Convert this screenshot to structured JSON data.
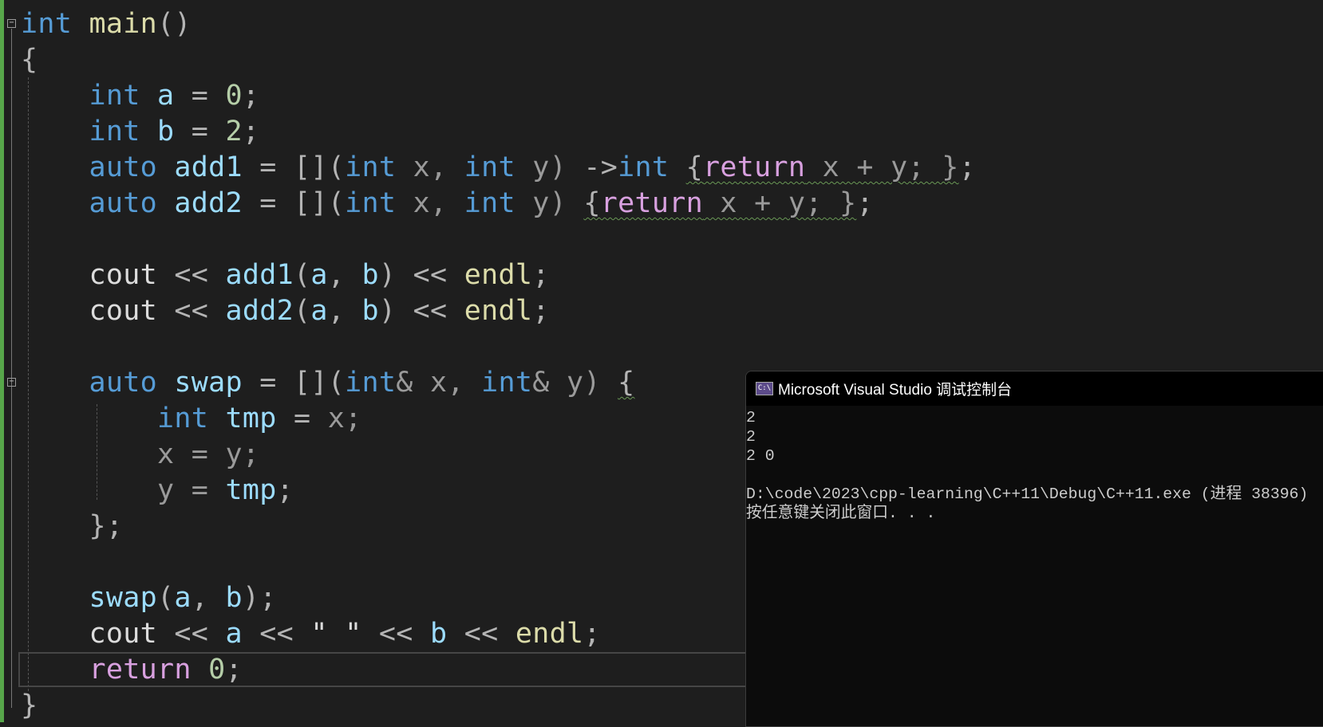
{
  "editor": {
    "lines": [
      [
        {
          "t": "int",
          "c": "kw"
        },
        {
          "t": " ",
          "c": "id"
        },
        {
          "t": "main",
          "c": "fn"
        },
        {
          "t": "()",
          "c": "pun"
        }
      ],
      [
        {
          "t": "{",
          "c": "pun"
        }
      ],
      [
        {
          "t": "    ",
          "c": "id"
        },
        {
          "t": "int",
          "c": "kw"
        },
        {
          "t": " ",
          "c": "id"
        },
        {
          "t": "a",
          "c": "var"
        },
        {
          "t": " = ",
          "c": "pun"
        },
        {
          "t": "0",
          "c": "num"
        },
        {
          "t": ";",
          "c": "pun"
        }
      ],
      [
        {
          "t": "    ",
          "c": "id"
        },
        {
          "t": "int",
          "c": "kw"
        },
        {
          "t": " ",
          "c": "id"
        },
        {
          "t": "b",
          "c": "var"
        },
        {
          "t": " = ",
          "c": "pun"
        },
        {
          "t": "2",
          "c": "num"
        },
        {
          "t": ";",
          "c": "pun"
        }
      ],
      [
        {
          "t": "    ",
          "c": "id"
        },
        {
          "t": "auto",
          "c": "kw"
        },
        {
          "t": " ",
          "c": "id"
        },
        {
          "t": "add1",
          "c": "var"
        },
        {
          "t": " = [](",
          "c": "pun"
        },
        {
          "t": "int",
          "c": "kw"
        },
        {
          "t": " x, ",
          "c": "par"
        },
        {
          "t": "int",
          "c": "kw"
        },
        {
          "t": " y) ",
          "c": "par"
        },
        {
          "t": "->",
          "c": "pun"
        },
        {
          "t": "int",
          "c": "kw"
        },
        {
          "t": " ",
          "c": "id"
        },
        {
          "t": "{",
          "c": "pun sq"
        },
        {
          "t": "return",
          "c": "ctl sq"
        },
        {
          "t": " x + y; }",
          "c": "par sq"
        },
        {
          "t": ";",
          "c": "pun"
        }
      ],
      [
        {
          "t": "    ",
          "c": "id"
        },
        {
          "t": "auto",
          "c": "kw"
        },
        {
          "t": " ",
          "c": "id"
        },
        {
          "t": "add2",
          "c": "var"
        },
        {
          "t": " = [](",
          "c": "pun"
        },
        {
          "t": "int",
          "c": "kw"
        },
        {
          "t": " x, ",
          "c": "par"
        },
        {
          "t": "int",
          "c": "kw"
        },
        {
          "t": " y) ",
          "c": "par"
        },
        {
          "t": "{",
          "c": "pun sq"
        },
        {
          "t": "return",
          "c": "ctl sq"
        },
        {
          "t": " x + y; }",
          "c": "par sq"
        },
        {
          "t": ";",
          "c": "pun"
        }
      ],
      [],
      [
        {
          "t": "    ",
          "c": "id"
        },
        {
          "t": "cout",
          "c": "id"
        },
        {
          "t": " << ",
          "c": "pun"
        },
        {
          "t": "add1",
          "c": "var"
        },
        {
          "t": "(",
          "c": "pun"
        },
        {
          "t": "a",
          "c": "var"
        },
        {
          "t": ", ",
          "c": "pun"
        },
        {
          "t": "b",
          "c": "var"
        },
        {
          "t": ") << ",
          "c": "pun"
        },
        {
          "t": "endl",
          "c": "fn"
        },
        {
          "t": ";",
          "c": "pun"
        }
      ],
      [
        {
          "t": "    ",
          "c": "id"
        },
        {
          "t": "cout",
          "c": "id"
        },
        {
          "t": " << ",
          "c": "pun"
        },
        {
          "t": "add2",
          "c": "var"
        },
        {
          "t": "(",
          "c": "pun"
        },
        {
          "t": "a",
          "c": "var"
        },
        {
          "t": ", ",
          "c": "pun"
        },
        {
          "t": "b",
          "c": "var"
        },
        {
          "t": ") << ",
          "c": "pun"
        },
        {
          "t": "endl",
          "c": "fn"
        },
        {
          "t": ";",
          "c": "pun"
        }
      ],
      [],
      [
        {
          "t": "    ",
          "c": "id"
        },
        {
          "t": "auto",
          "c": "kw"
        },
        {
          "t": " ",
          "c": "id"
        },
        {
          "t": "swap",
          "c": "var"
        },
        {
          "t": " = [](",
          "c": "pun"
        },
        {
          "t": "int",
          "c": "kw"
        },
        {
          "t": "& x, ",
          "c": "par"
        },
        {
          "t": "int",
          "c": "kw"
        },
        {
          "t": "& y) ",
          "c": "par"
        },
        {
          "t": "{",
          "c": "pun sq"
        }
      ],
      [
        {
          "t": "        ",
          "c": "id"
        },
        {
          "t": "int",
          "c": "kw"
        },
        {
          "t": " ",
          "c": "id"
        },
        {
          "t": "tmp",
          "c": "var"
        },
        {
          "t": " = ",
          "c": "pun"
        },
        {
          "t": "x;",
          "c": "par"
        }
      ],
      [
        {
          "t": "        ",
          "c": "id"
        },
        {
          "t": "x = y;",
          "c": "par"
        }
      ],
      [
        {
          "t": "        ",
          "c": "id"
        },
        {
          "t": "y = ",
          "c": "par"
        },
        {
          "t": "tmp",
          "c": "var"
        },
        {
          "t": ";",
          "c": "pun"
        }
      ],
      [
        {
          "t": "    ",
          "c": "id"
        },
        {
          "t": "};",
          "c": "pun"
        }
      ],
      [],
      [
        {
          "t": "    ",
          "c": "id"
        },
        {
          "t": "swap",
          "c": "var"
        },
        {
          "t": "(",
          "c": "pun"
        },
        {
          "t": "a",
          "c": "var"
        },
        {
          "t": ", ",
          "c": "pun"
        },
        {
          "t": "b",
          "c": "var"
        },
        {
          "t": ");",
          "c": "pun"
        }
      ],
      [
        {
          "t": "    ",
          "c": "id"
        },
        {
          "t": "cout",
          "c": "id"
        },
        {
          "t": " << ",
          "c": "pun"
        },
        {
          "t": "a",
          "c": "var"
        },
        {
          "t": " << ",
          "c": "pun"
        },
        {
          "t": "\" \"",
          "c": "id"
        },
        {
          "t": " << ",
          "c": "pun"
        },
        {
          "t": "b",
          "c": "var"
        },
        {
          "t": " << ",
          "c": "pun"
        },
        {
          "t": "endl",
          "c": "fn"
        },
        {
          "t": ";",
          "c": "pun"
        }
      ],
      [
        {
          "t": "    ",
          "c": "id"
        },
        {
          "t": "return",
          "c": "ctl"
        },
        {
          "t": " ",
          "c": "id"
        },
        {
          "t": "0",
          "c": "num"
        },
        {
          "t": ";",
          "c": "pun"
        }
      ],
      [
        {
          "t": "}",
          "c": "pun"
        }
      ]
    ],
    "fold_glyph": "⊟",
    "change_bar_color": "#57a64a"
  },
  "console": {
    "title": "Microsoft Visual Studio 调试控制台",
    "icon": "console-app-icon",
    "icon_text": "C:\\",
    "lines": [
      "2",
      "2",
      "2 0",
      "",
      "D:\\code\\2023\\cpp-learning\\C++11\\Debug\\C++11.exe (进程 38396)",
      "按任意键关闭此窗口. . ."
    ]
  }
}
